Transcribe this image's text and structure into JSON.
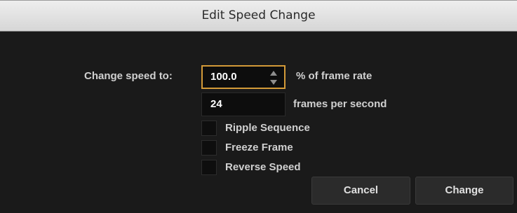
{
  "dialog": {
    "title": "Edit Speed Change"
  },
  "speed": {
    "label": "Change speed to:",
    "value": "100.0",
    "unit": "% of frame rate"
  },
  "fps": {
    "value": "24",
    "unit": "frames per second"
  },
  "options": {
    "ripple_sequence": {
      "label": "Ripple Sequence",
      "checked": false
    },
    "freeze_frame": {
      "label": "Freeze Frame",
      "checked": false
    },
    "reverse_speed": {
      "label": "Reverse Speed",
      "checked": false
    }
  },
  "buttons": {
    "cancel": "Cancel",
    "change": "Change"
  },
  "colors": {
    "focus_ring": "#d39a38",
    "background": "#1a1a1a"
  },
  "icons": {
    "stepper": "up-down-stepper-icon"
  }
}
